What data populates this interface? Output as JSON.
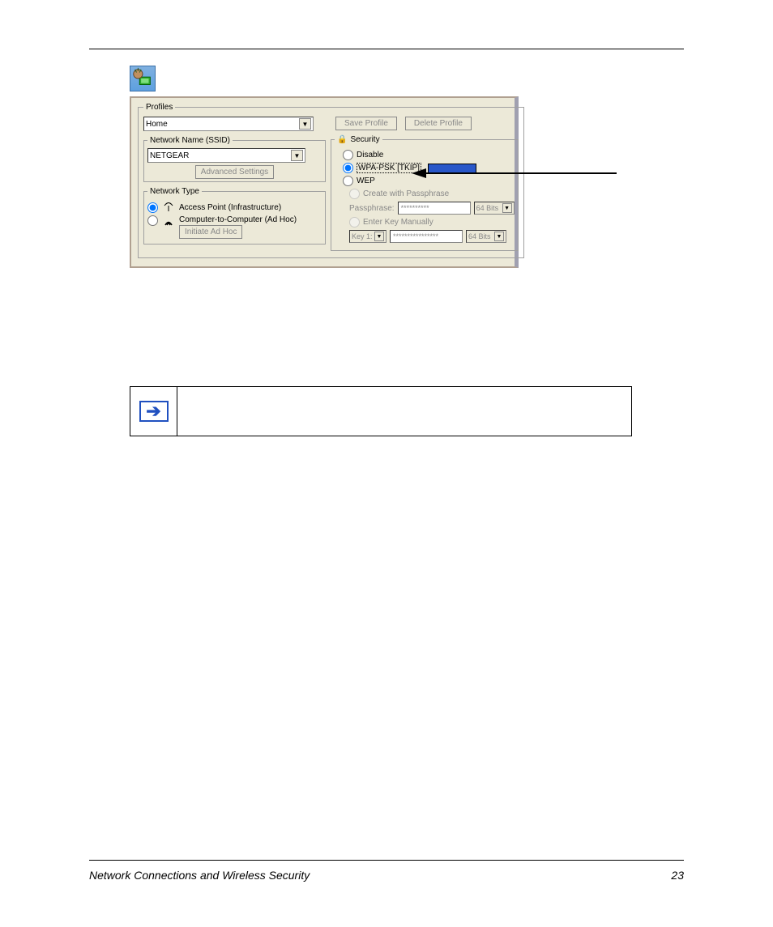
{
  "dialog": {
    "profiles_legend": "Profiles",
    "profile_value": "Home",
    "network_name_legend": "Network Name (SSID)",
    "ssid_value": "NETGEAR",
    "advanced_button": "Advanced Settings",
    "network_type_legend": "Network Type",
    "nt_option1": "Access Point (Infrastructure)",
    "nt_option2": "Computer-to-Computer (Ad Hoc)",
    "initiate_button": "Initiate Ad Hoc",
    "save_profile": "Save Profile",
    "delete_profile": "Delete Profile",
    "security_legend": "Security",
    "sec_disable": "Disable",
    "sec_wpapsk": "WPA-PSK [TKIP]",
    "sec_wep": "WEP",
    "create_passphrase": "Create with Passphrase",
    "passphrase_label": "Passphrase:",
    "passphrase_value": "**********",
    "bits64": "64 Bits",
    "enter_key_manually": "Enter Key Manually",
    "key1_label": "Key 1:",
    "key_value": "****************"
  },
  "footer": {
    "left": "Network Connections and Wireless Security",
    "right": "23"
  }
}
